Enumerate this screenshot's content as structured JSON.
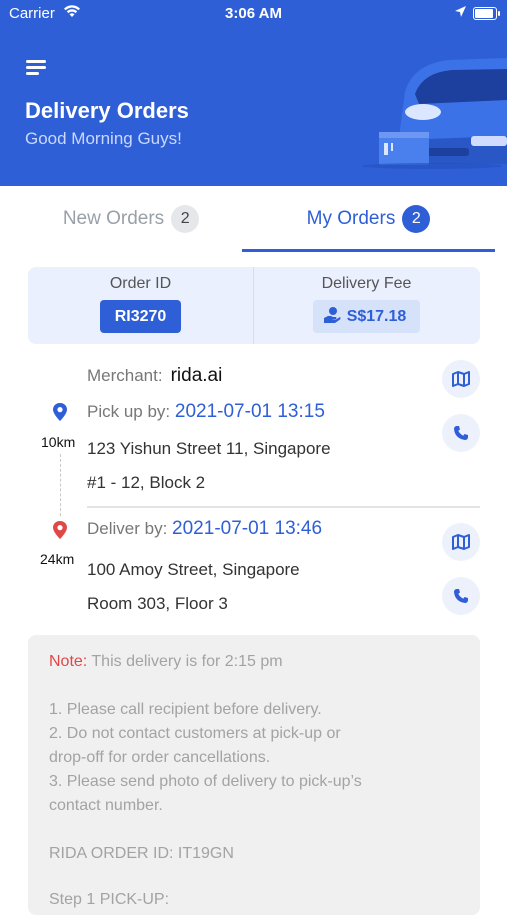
{
  "status_bar": {
    "carrier": "Carrier",
    "time": "3:06 AM"
  },
  "header": {
    "title": "Delivery Orders",
    "subtitle": "Good Morning Guys!"
  },
  "tabs": {
    "new": {
      "label": "New Orders",
      "count": "2"
    },
    "my": {
      "label": "My Orders",
      "count": "2"
    }
  },
  "order": {
    "id_label": "Order ID",
    "id": "RI3270",
    "fee_label": "Delivery Fee",
    "fee": "S$17.18"
  },
  "merchant": {
    "label": "Merchant:",
    "name": "rida.ai"
  },
  "pickup": {
    "label": "Pick up by:",
    "time": "2021-07-01 13:15",
    "distance": "10km",
    "address_line1": "123 Yishun Street 11, Singapore",
    "address_line2": "#1 - 12, Block 2"
  },
  "delivery": {
    "label": "Deliver by:",
    "time": "2021-07-01 13:46",
    "distance": "24km",
    "address_line1": "100 Amoy Street, Singapore",
    "address_line2": "Room 303, Floor 3"
  },
  "note": {
    "label": "Note:",
    "text": "This delivery is for 2:15 pm",
    "lines": [
      "1. Please call recipient before delivery.",
      "2. Do not contact customers at pick-up or",
      "drop-off for order cancellations.",
      "3. Please send photo of delivery to pick-up’s",
      "contact number."
    ],
    "order_ref": "RIDA ORDER ID: IT19GN",
    "step": "Step 1 PICK-UP:"
  },
  "colors": {
    "primary": "#2f5fd6",
    "pickup_pin": "#2f5fd6",
    "deliver_pin": "#e04848",
    "note_red": "#e04848"
  },
  "icons": [
    "menu-icon",
    "map-icon",
    "phone-icon",
    "location-pin-icon",
    "hand-coin-icon",
    "wifi-icon",
    "battery-icon",
    "location-arrow-icon"
  ]
}
